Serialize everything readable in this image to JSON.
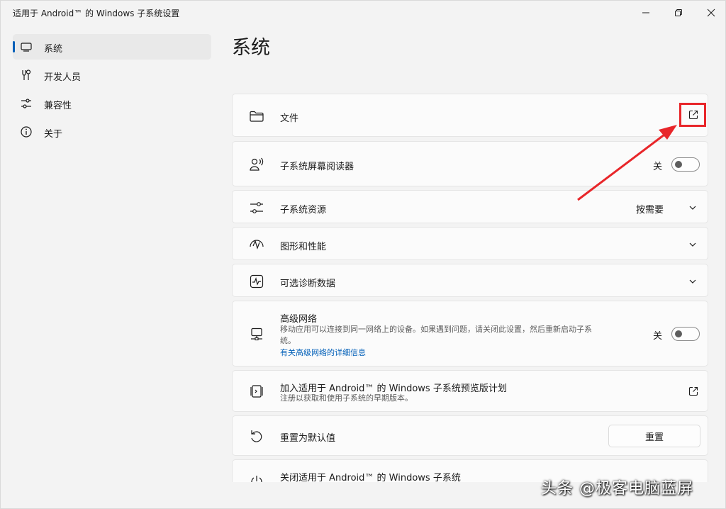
{
  "window": {
    "title": "适用于 Android™ 的 Windows 子系统设置"
  },
  "sidebar": {
    "items": [
      {
        "label": "系统",
        "icon": "monitor-icon",
        "selected": true
      },
      {
        "label": "开发人员",
        "icon": "tools-icon",
        "selected": false
      },
      {
        "label": "兼容性",
        "icon": "sliders-icon",
        "selected": false
      },
      {
        "label": "关于",
        "icon": "info-icon",
        "selected": false
      }
    ]
  },
  "main": {
    "page_title": "系统",
    "cards": {
      "files": {
        "title": "文件",
        "icon": "folder-icon"
      },
      "screen_reader": {
        "title": "子系统屏幕阅读器",
        "toggle_label": "关",
        "icon": "person-voice-icon"
      },
      "resources": {
        "title": "子系统资源",
        "value": "按需要",
        "icon": "sliders-icon"
      },
      "graphics": {
        "title": "图形和性能",
        "icon": "graphics-icon"
      },
      "diagnostics": {
        "title": "可选诊断数据",
        "icon": "pulse-icon"
      },
      "network": {
        "title": "高级网络",
        "description": "移动应用可以连接到同一网络上的设备。如果遇到问题，请关闭此设置，然后重新启动子系统。",
        "link": "有关高级网络的详细信息",
        "toggle_label": "关",
        "icon": "network-icon"
      },
      "preview": {
        "title": "加入适用于 Android™ 的 Windows 子系统预览版计划",
        "description": "注册以获取和使用子系统的早期版本。",
        "icon": "preview-icon"
      },
      "reset": {
        "title": "重置为默认值",
        "button": "重置",
        "icon": "reset-icon"
      },
      "shutdown": {
        "title": "关闭适用于 Android™ 的 Windows 子系统",
        "icon": "power-icon"
      }
    }
  },
  "annotation": {
    "color": "#e8262a"
  },
  "watermark": "头条 @极客电脑蓝屏",
  "colors": {
    "accent": "#005fb8",
    "background": "#f3f3f3",
    "card": "#fbfbfb"
  }
}
